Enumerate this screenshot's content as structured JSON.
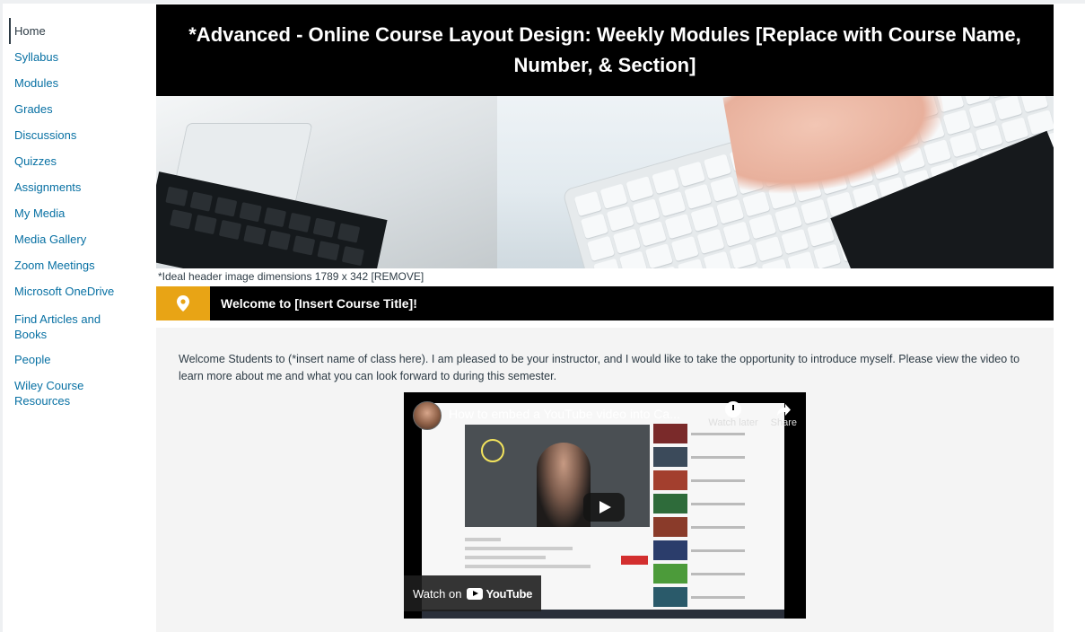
{
  "sidebar": {
    "items": [
      {
        "label": "Home",
        "active": true
      },
      {
        "label": "Syllabus"
      },
      {
        "label": "Modules"
      },
      {
        "label": "Grades"
      },
      {
        "label": "Discussions"
      },
      {
        "label": "Quizzes"
      },
      {
        "label": "Assignments"
      },
      {
        "label": "My Media"
      },
      {
        "label": "Media Gallery"
      },
      {
        "label": "Zoom Meetings"
      },
      {
        "label": "Microsoft OneDrive"
      },
      {
        "label": "Find Articles and Books"
      },
      {
        "label": "People"
      },
      {
        "label": "Wiley Course Resources"
      }
    ]
  },
  "header": {
    "title_line1": "*Advanced - Online Course Layout Design: Weekly Modules [Replace with Course Name,",
    "title_line2": "Number, & Section]"
  },
  "hero": {
    "note": "*Ideal header image dimensions 1789 x 342 [REMOVE]"
  },
  "welcome": {
    "heading": "Welcome to [Insert Course Title]!",
    "icon": "map-pin-icon",
    "accent_color": "#e8a415"
  },
  "intro_text": "Welcome Students to (*insert name of class here). I am pleased to be your instructor, and I would like to take the opportunity to introduce myself. Please view the video to learn more about me and what you can look forward to during this semester.",
  "video": {
    "title": "How to embed a YouTube video into Ca...",
    "watch_later": "Watch later",
    "share": "Share",
    "watch_on": "Watch on",
    "platform": "YouTube"
  },
  "colors": {
    "link": "#0770a3",
    "text": "#2d3b45",
    "bar": "#000000",
    "panel": "#f4f4f4"
  }
}
